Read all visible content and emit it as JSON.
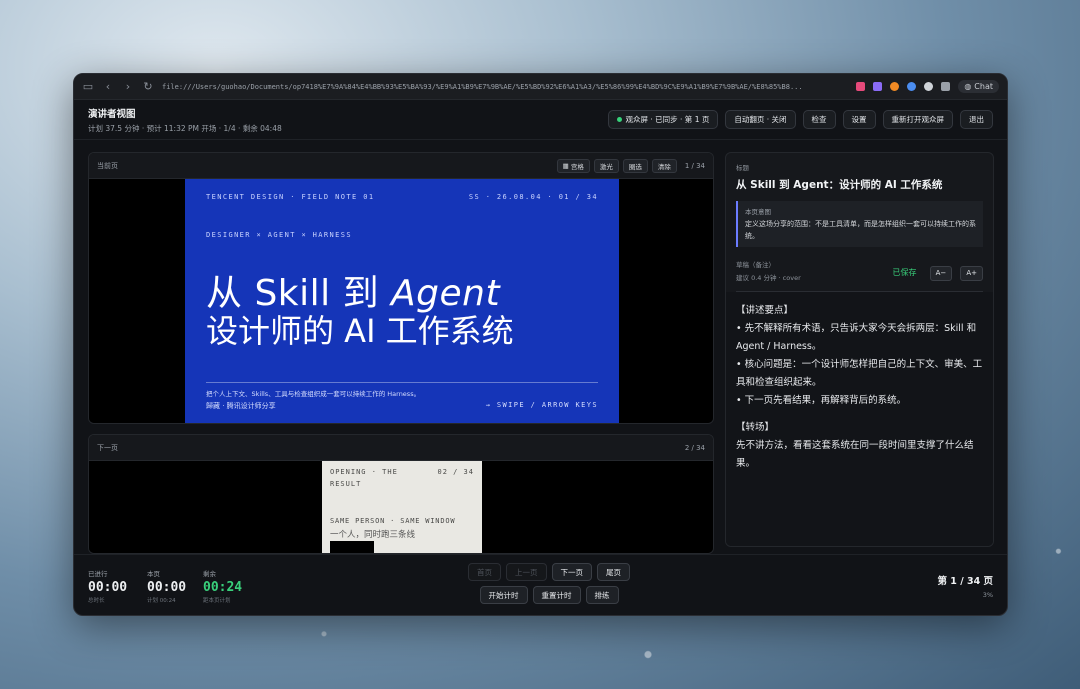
{
  "browser": {
    "url": "file:///Users/guohao/Documents/op7418%E7%9A%84%E4%BB%93%E5%BA%93/%E9%A1%B9%E7%9B%AE/%E5%BD%92%E6%A1%A3/%E5%86%99%E4%BD%9C%E9%A1%B9%E7%9B%AE/%E8%85%B8...",
    "chat_label": "Chat"
  },
  "header": {
    "title": "演讲者视图",
    "subtitle": "计划 37.5 分钟 · 预计 11:32 PM   开场 · 1/4 · 剩余 04:48",
    "status": "观众屏 · 已同步 · 第 1 页",
    "auto_flip": "自动翻页 · 关闭",
    "check": "检查",
    "settings": "设置",
    "reopen": "重新打开观众屏",
    "exit": "退出"
  },
  "current": {
    "label": "当前页",
    "tools": [
      "宫格",
      "激光",
      "圈选",
      "清除"
    ],
    "count": "1 / 34",
    "slide": {
      "top_left": "TENCENT DESIGN · FIELD NOTE 01",
      "top_right": "SS · 26.08.04 · 01 / 34",
      "tags": "DESIGNER × AGENT × HARNESS",
      "title1_pre": "从 Skill 到 ",
      "title1_em": "Agent",
      "title2": "设计师的 AI 工作系统",
      "desc": "把个人上下文、Skills、工具与检查组织成一套可以持续工作的 Harness。",
      "foot_left": "歸藏 · 腾讯设计师分享",
      "foot_right": "→ SWIPE / ARROW KEYS"
    }
  },
  "next": {
    "label": "下一页",
    "count": "2 / 34",
    "slide": {
      "top_left": "OPENING · THE",
      "top_right": "02 / 34",
      "result": "RESULT",
      "same_left": "SAME PERSON · SAME WINDOW",
      "cn": "一个人，同时跑三条线"
    }
  },
  "notes_panel": {
    "title_label": "标题",
    "title": "从 Skill 到 Agent：设计师的 AI 工作系统",
    "purpose_label": "本页意图",
    "purpose": "定义这场分享的范围：不是工具清单，而是怎样组织一套可以持续工作的系统。",
    "draft_label": "草稿（备注）",
    "draft_sub": "建议 0.4 分钟 · cover",
    "saved": "已保存",
    "font_minus": "A−",
    "font_plus": "A+",
    "notes": {
      "h1": "【讲述要点】",
      "b1": "• 先不解释所有术语，只告诉大家今天会拆两层：Skill 和 Agent / Harness。",
      "b2": "• 核心问题是：一个设计师怎样把自己的上下文、审美、工具和检查组织起来。",
      "b3": "• 下一页先看结果，再解释背后的系统。",
      "h2": "【转场】",
      "t2": "先不讲方法，看看这套系统在同一段时间里支撑了什么结果。"
    }
  },
  "footer": {
    "elapsed_label": "已进行",
    "elapsed": "00:00",
    "elapsed_sub": "总时长",
    "page_label": "本页",
    "page_time": "00:00",
    "page_sub": "计划 00:24",
    "remain_label": "剩余",
    "remain": "00:24",
    "remain_sub": "距本页计划",
    "first": "首页",
    "prev": "上一页",
    "next": "下一页",
    "last": "尾页",
    "start": "开始计时",
    "reset": "重置计时",
    "rehearse": "排练",
    "page_info": "第 1 / 34 页",
    "percent": "3%"
  }
}
